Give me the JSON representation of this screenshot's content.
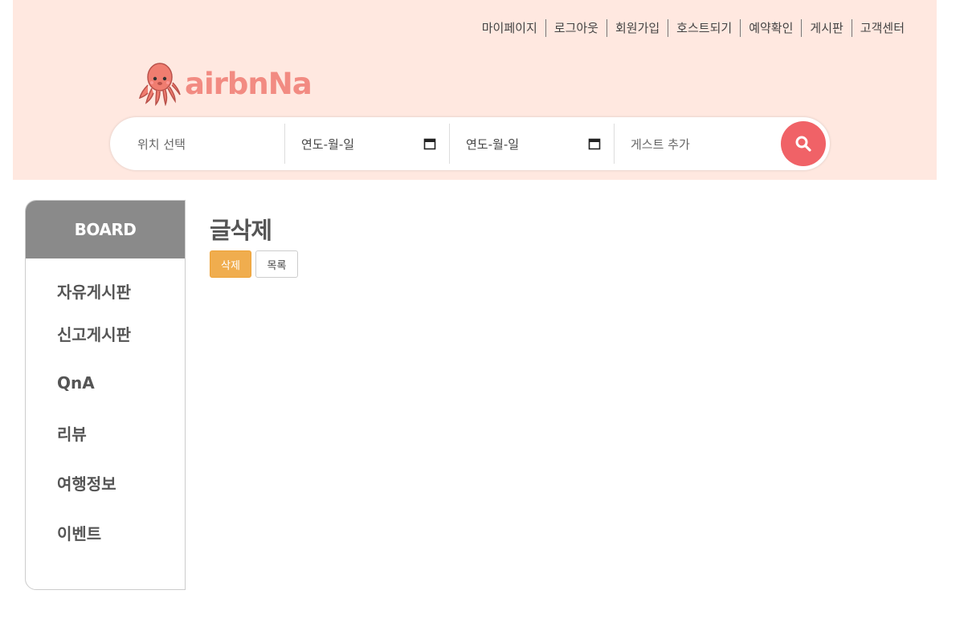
{
  "header": {
    "nav": [
      "마이페이지",
      "로그아웃",
      "회원가입",
      "호스트되기",
      "예약확인",
      "게시판",
      "고객센터"
    ],
    "logo_text": "airbnNa",
    "accent_color": "#f06267",
    "background_color": "#ffe8e0"
  },
  "search": {
    "location_placeholder": "위치 선택",
    "checkin_placeholder": "연도-월-일",
    "checkout_placeholder": "연도-월-일",
    "guest_placeholder": "게스트 추가",
    "button_icon": "search-icon"
  },
  "sidebar": {
    "title": "BOARD",
    "items": [
      "자유게시판",
      "신고게시판",
      "QnA",
      "리뷰",
      "여행정보",
      "이벤트"
    ]
  },
  "main": {
    "title": "글삭제",
    "delete_label": "삭제",
    "list_label": "목록",
    "delete_color": "#f0ad4e"
  }
}
